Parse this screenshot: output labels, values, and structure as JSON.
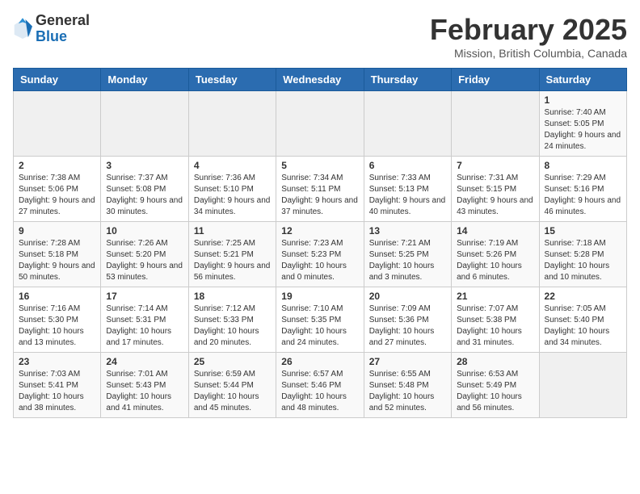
{
  "header": {
    "logo_line1": "General",
    "logo_line2": "Blue",
    "title": "February 2025",
    "subtitle": "Mission, British Columbia, Canada"
  },
  "weekdays": [
    "Sunday",
    "Monday",
    "Tuesday",
    "Wednesday",
    "Thursday",
    "Friday",
    "Saturday"
  ],
  "weeks": [
    [
      {
        "day": "",
        "info": ""
      },
      {
        "day": "",
        "info": ""
      },
      {
        "day": "",
        "info": ""
      },
      {
        "day": "",
        "info": ""
      },
      {
        "day": "",
        "info": ""
      },
      {
        "day": "",
        "info": ""
      },
      {
        "day": "1",
        "info": "Sunrise: 7:40 AM\nSunset: 5:05 PM\nDaylight: 9 hours and 24 minutes."
      }
    ],
    [
      {
        "day": "2",
        "info": "Sunrise: 7:38 AM\nSunset: 5:06 PM\nDaylight: 9 hours and 27 minutes."
      },
      {
        "day": "3",
        "info": "Sunrise: 7:37 AM\nSunset: 5:08 PM\nDaylight: 9 hours and 30 minutes."
      },
      {
        "day": "4",
        "info": "Sunrise: 7:36 AM\nSunset: 5:10 PM\nDaylight: 9 hours and 34 minutes."
      },
      {
        "day": "5",
        "info": "Sunrise: 7:34 AM\nSunset: 5:11 PM\nDaylight: 9 hours and 37 minutes."
      },
      {
        "day": "6",
        "info": "Sunrise: 7:33 AM\nSunset: 5:13 PM\nDaylight: 9 hours and 40 minutes."
      },
      {
        "day": "7",
        "info": "Sunrise: 7:31 AM\nSunset: 5:15 PM\nDaylight: 9 hours and 43 minutes."
      },
      {
        "day": "8",
        "info": "Sunrise: 7:29 AM\nSunset: 5:16 PM\nDaylight: 9 hours and 46 minutes."
      }
    ],
    [
      {
        "day": "9",
        "info": "Sunrise: 7:28 AM\nSunset: 5:18 PM\nDaylight: 9 hours and 50 minutes."
      },
      {
        "day": "10",
        "info": "Sunrise: 7:26 AM\nSunset: 5:20 PM\nDaylight: 9 hours and 53 minutes."
      },
      {
        "day": "11",
        "info": "Sunrise: 7:25 AM\nSunset: 5:21 PM\nDaylight: 9 hours and 56 minutes."
      },
      {
        "day": "12",
        "info": "Sunrise: 7:23 AM\nSunset: 5:23 PM\nDaylight: 10 hours and 0 minutes."
      },
      {
        "day": "13",
        "info": "Sunrise: 7:21 AM\nSunset: 5:25 PM\nDaylight: 10 hours and 3 minutes."
      },
      {
        "day": "14",
        "info": "Sunrise: 7:19 AM\nSunset: 5:26 PM\nDaylight: 10 hours and 6 minutes."
      },
      {
        "day": "15",
        "info": "Sunrise: 7:18 AM\nSunset: 5:28 PM\nDaylight: 10 hours and 10 minutes."
      }
    ],
    [
      {
        "day": "16",
        "info": "Sunrise: 7:16 AM\nSunset: 5:30 PM\nDaylight: 10 hours and 13 minutes."
      },
      {
        "day": "17",
        "info": "Sunrise: 7:14 AM\nSunset: 5:31 PM\nDaylight: 10 hours and 17 minutes."
      },
      {
        "day": "18",
        "info": "Sunrise: 7:12 AM\nSunset: 5:33 PM\nDaylight: 10 hours and 20 minutes."
      },
      {
        "day": "19",
        "info": "Sunrise: 7:10 AM\nSunset: 5:35 PM\nDaylight: 10 hours and 24 minutes."
      },
      {
        "day": "20",
        "info": "Sunrise: 7:09 AM\nSunset: 5:36 PM\nDaylight: 10 hours and 27 minutes."
      },
      {
        "day": "21",
        "info": "Sunrise: 7:07 AM\nSunset: 5:38 PM\nDaylight: 10 hours and 31 minutes."
      },
      {
        "day": "22",
        "info": "Sunrise: 7:05 AM\nSunset: 5:40 PM\nDaylight: 10 hours and 34 minutes."
      }
    ],
    [
      {
        "day": "23",
        "info": "Sunrise: 7:03 AM\nSunset: 5:41 PM\nDaylight: 10 hours and 38 minutes."
      },
      {
        "day": "24",
        "info": "Sunrise: 7:01 AM\nSunset: 5:43 PM\nDaylight: 10 hours and 41 minutes."
      },
      {
        "day": "25",
        "info": "Sunrise: 6:59 AM\nSunset: 5:44 PM\nDaylight: 10 hours and 45 minutes."
      },
      {
        "day": "26",
        "info": "Sunrise: 6:57 AM\nSunset: 5:46 PM\nDaylight: 10 hours and 48 minutes."
      },
      {
        "day": "27",
        "info": "Sunrise: 6:55 AM\nSunset: 5:48 PM\nDaylight: 10 hours and 52 minutes."
      },
      {
        "day": "28",
        "info": "Sunrise: 6:53 AM\nSunset: 5:49 PM\nDaylight: 10 hours and 56 minutes."
      },
      {
        "day": "",
        "info": ""
      }
    ]
  ]
}
